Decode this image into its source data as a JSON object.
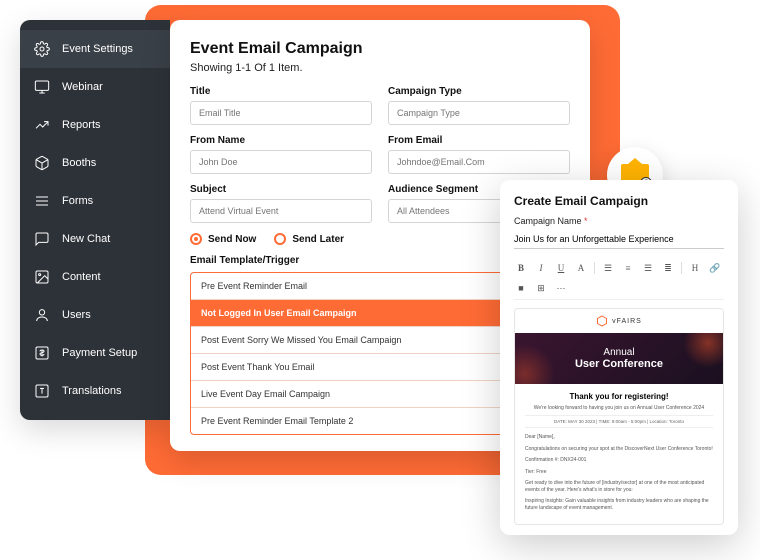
{
  "sidebar": {
    "items": [
      {
        "label": "Event Settings"
      },
      {
        "label": "Webinar"
      },
      {
        "label": "Reports"
      },
      {
        "label": "Booths"
      },
      {
        "label": "Forms"
      },
      {
        "label": "New Chat"
      },
      {
        "label": "Content"
      },
      {
        "label": "Users"
      },
      {
        "label": "Payment Setup"
      },
      {
        "label": "Translations"
      }
    ]
  },
  "main": {
    "title": "Event Email Campaign",
    "subtitle": "Showing 1-1 Of 1 Item.",
    "fields": {
      "title_label": "Title",
      "title_placeholder": "Email Title",
      "type_label": "Campaign Type",
      "type_placeholder": "Campaign Type",
      "from_name_label": "From Name",
      "from_name_value": "John Doe",
      "from_email_label": "From Email",
      "from_email_value": "Johndoe@Email.Com",
      "subject_label": "Subject",
      "subject_value": "Attend Virtual Event",
      "segment_label": "Audience Segment",
      "segment_value": "All Attendees"
    },
    "send_now_label": "Send Now",
    "send_later_label": "Send Later",
    "template_label": "Email Template/Trigger",
    "templates": [
      "Pre Event Reminder Email",
      "Not Logged In User Email Campaign",
      "Post Event Sorry We Missed You Email Campaign",
      "Post Event Thank You Email",
      "Live Event Day Email Campaign",
      "Pre Event Reminder Email Template 2"
    ]
  },
  "editor": {
    "title": "Create Email Campaign",
    "name_label": "Campaign Name",
    "name_value": "Join Us for an Unforgettable Experience",
    "brand": "vFAIRS",
    "hero_line1": "Annual",
    "hero_line2": "User Conference",
    "thanks": "Thank you for registering!",
    "thanks_sub": "We're looking forward to having you join us on Annual User Conference 2024",
    "meta": "DATE: MAY 30 2023   |   TIME: 9:00am - 5:00pm   |   Location: Toronto",
    "p1": "Dear [Name],",
    "p2": "Congratulations on securing your spot at the DiscoverNext User Conference Toronto!",
    "p3": "Confirmation #: DNX24-001",
    "p4": "Tier: Free",
    "p5": "Get ready to dive into the future of [industry/sector] at one of the most anticipated events of the year. Here's what's in store for you:",
    "p6": "Inspiring Insights: Gain valuable insights from industry leaders who are shaping the future landscape of event management."
  }
}
